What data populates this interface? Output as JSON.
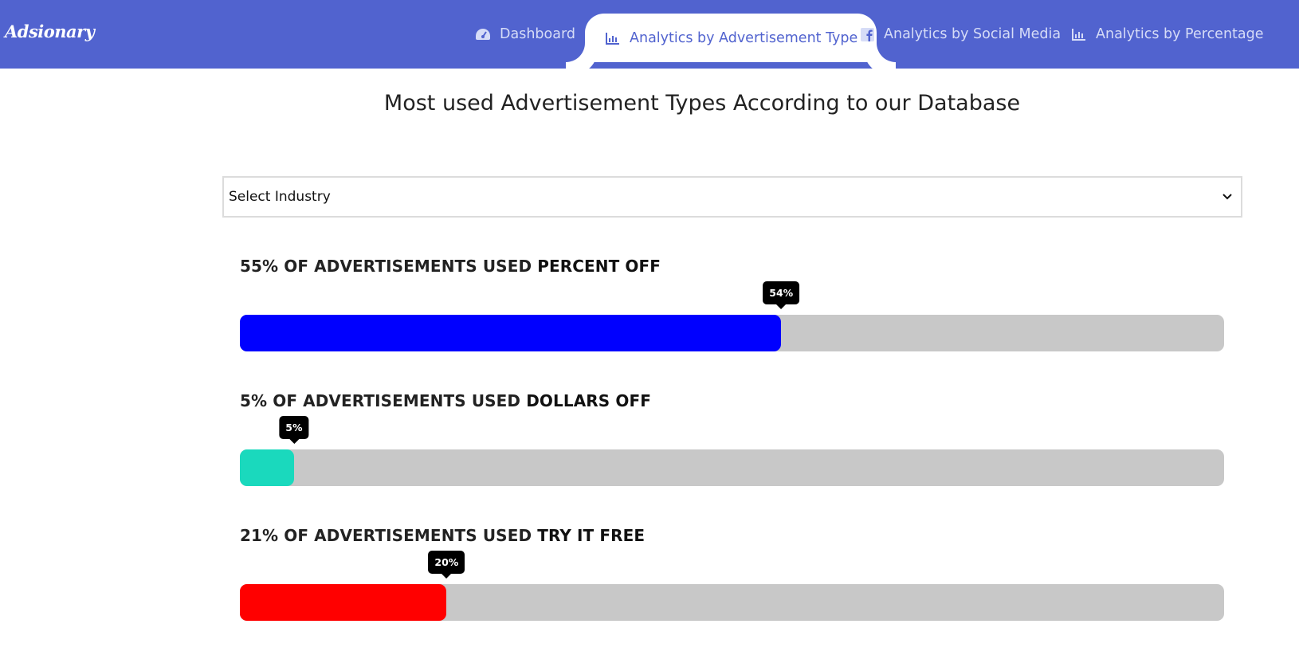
{
  "nav": {
    "brand": "Adsionary",
    "items": [
      {
        "label": "Dashboard",
        "icon": "gauge-icon",
        "active": false
      },
      {
        "label": "Analytics by Advertisement Type",
        "icon": "bar-chart-icon",
        "active": true
      },
      {
        "label": "Analytics by Social Media",
        "icon": "facebook-icon",
        "active": false
      },
      {
        "label": "Analytics by Percentage",
        "icon": "bar-chart-icon",
        "active": false
      }
    ],
    "colors": {
      "bar": "#5163cf",
      "inactive_text": "#d6dcf7",
      "active_text": "#5163cf"
    }
  },
  "page": {
    "title": "Most used Advertisement Types According to our Database"
  },
  "industry_select": {
    "value": "Select Industry"
  },
  "metrics": [
    {
      "label_prefix": "55% OF ADVERTISEMENTS USED ",
      "label_type": "PERCENT OFF",
      "tooltip": "54%",
      "value": 55,
      "color": "#0000ff"
    },
    {
      "label_prefix": "5% OF ADVERTISEMENTS USED ",
      "label_type": "DOLLARS OFF",
      "tooltip": "5%",
      "value": 5.5,
      "color": "#1ad9bd"
    },
    {
      "label_prefix": "21% OF ADVERTISEMENTS USED ",
      "label_type": "TRY IT FREE",
      "tooltip": "20%",
      "value": 21,
      "color": "#ff0000"
    }
  ]
}
